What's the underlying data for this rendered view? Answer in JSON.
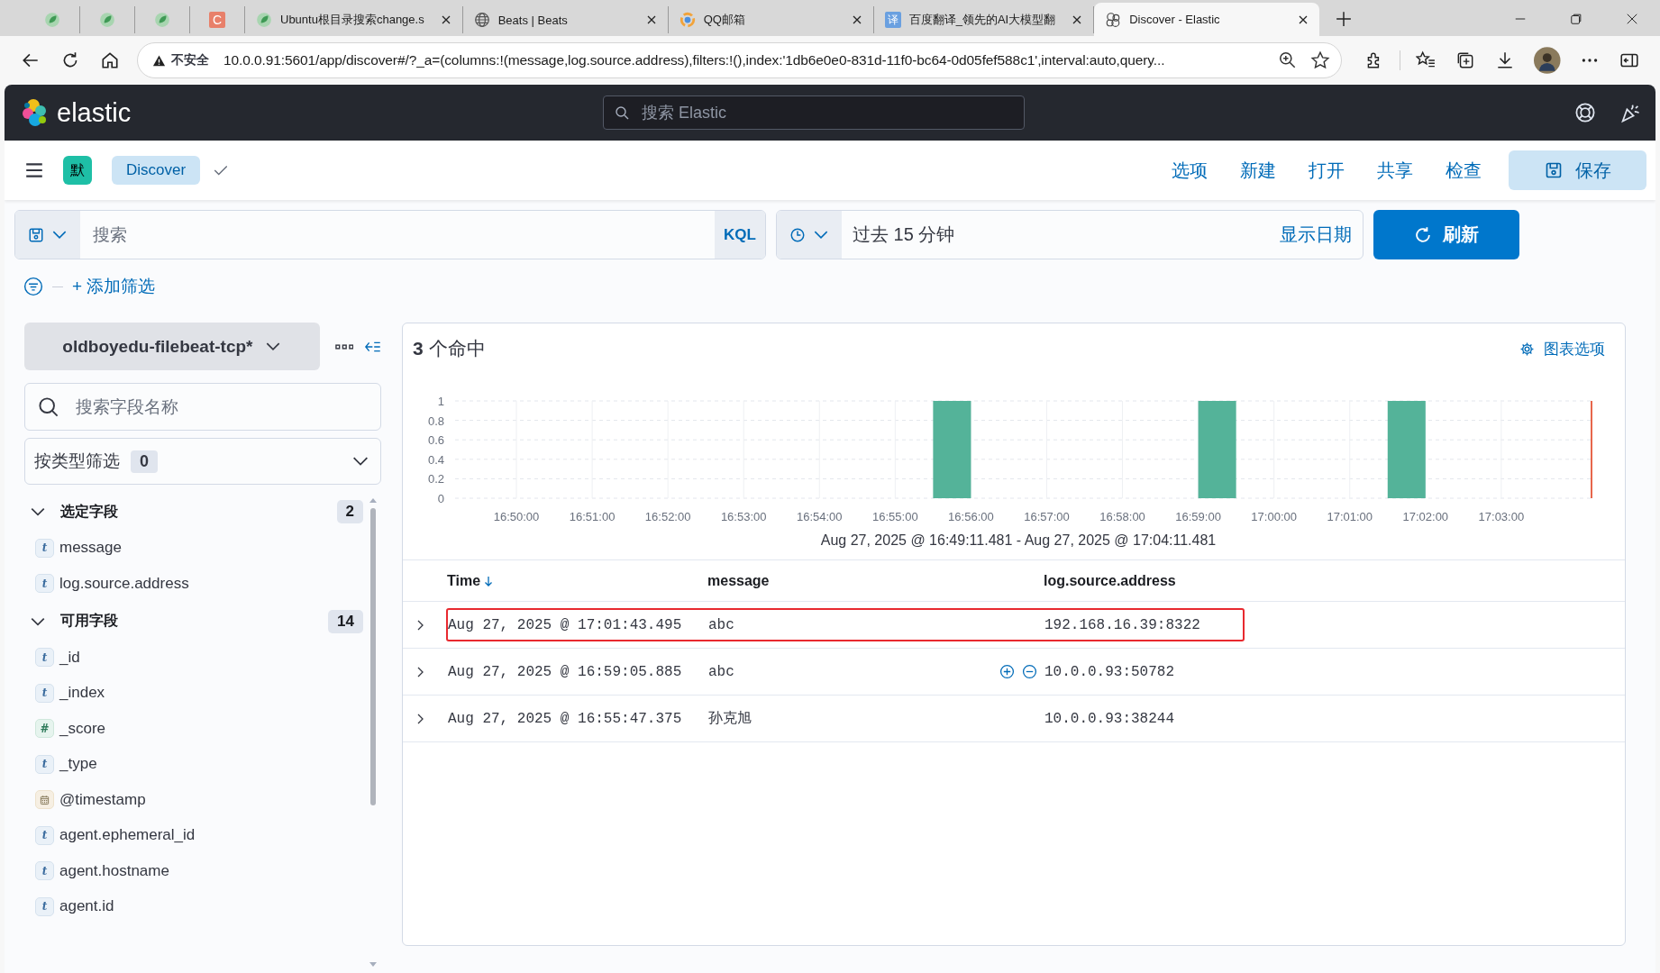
{
  "browser": {
    "tabs": [
      {
        "kind": "leaf",
        "selected": false
      },
      {
        "kind": "leaf",
        "selected": false
      },
      {
        "kind": "leaf",
        "selected": false
      },
      {
        "kind": "letter",
        "icon_text": "C",
        "selected": false
      },
      {
        "kind": "leaf",
        "title": "Ubuntu根目录搜索change.s",
        "selected": false
      },
      {
        "kind": "globe",
        "title": "Beats | Beats",
        "selected": false
      },
      {
        "kind": "ring",
        "title": "QQ邮箱",
        "selected": false
      },
      {
        "kind": "translate",
        "icon_text": "译",
        "title": "百度翻译_领先的AI大模型翻",
        "selected": false
      },
      {
        "kind": "elastic",
        "title": "Discover - Elastic",
        "selected": true
      }
    ],
    "security_label": "不安全",
    "url": "10.0.0.91:5601/app/discover#/?_a=(columns:!(message,log.source.address),filters:!(),index:'1db6e0e0-831d-11f0-bc64-0d05fef588c1',interval:auto,query..."
  },
  "header": {
    "brand": "elastic",
    "search_placeholder": "搜索 Elastic"
  },
  "app_bar": {
    "space_initial": "默",
    "breadcrumb": "Discover",
    "menu": [
      "选项",
      "新建",
      "打开",
      "共享",
      "检查"
    ],
    "save_label": "保存"
  },
  "query": {
    "placeholder": "搜索",
    "language": "KQL",
    "time_range": "过去 15 分钟",
    "show_dates": "显示日期",
    "refresh_label": "刷新"
  },
  "filters": {
    "add_label": "+ 添加筛选"
  },
  "sidebar": {
    "index_pattern": "oldboyedu-filebeat-tcp*",
    "field_search_placeholder": "搜索字段名称",
    "type_filter": {
      "label": "按类型筛选",
      "count": "0"
    },
    "sections": [
      {
        "title": "选定字段",
        "count": "2",
        "expanded": true,
        "fields": [
          {
            "name": "message",
            "kind": "string",
            "type_icon": "t"
          },
          {
            "name": "log.source.address",
            "kind": "string",
            "type_icon": "t"
          }
        ]
      },
      {
        "title": "可用字段",
        "count": "14",
        "expanded": true,
        "fields": [
          {
            "name": "_id",
            "kind": "string",
            "type_icon": "t"
          },
          {
            "name": "_index",
            "kind": "string",
            "type_icon": "t"
          },
          {
            "name": "_score",
            "kind": "number",
            "type_icon": "#"
          },
          {
            "name": "_type",
            "kind": "string",
            "type_icon": "t"
          },
          {
            "name": "@timestamp",
            "kind": "date"
          },
          {
            "name": "agent.ephemeral_id",
            "kind": "string",
            "type_icon": "t"
          },
          {
            "name": "agent.hostname",
            "kind": "string",
            "type_icon": "t"
          },
          {
            "name": "agent.id",
            "kind": "string",
            "type_icon": "t"
          }
        ]
      }
    ]
  },
  "results": {
    "hits_count": "3",
    "hits_label": "个命中",
    "chart_options": "图表选项",
    "chart_data": {
      "type": "bar",
      "x": [
        1015.75,
        1019.25,
        1021.75
      ],
      "values": [
        1,
        1,
        1
      ],
      "color": "#54b399",
      "grid": true,
      "xlim": [
        1009.191,
        1024.191
      ],
      "ylim": [
        0,
        1
      ],
      "yticks": [
        {
          "value": 0,
          "label": "0"
        },
        {
          "value": 0.2,
          "label": "0.2"
        },
        {
          "value": 0.4,
          "label": "0.4"
        },
        {
          "value": 0.6,
          "label": "0.6"
        },
        {
          "value": 0.8,
          "label": "0.8"
        },
        {
          "value": 1,
          "label": "1"
        }
      ],
      "xticks": [
        {
          "value": 1010,
          "label": "16:50:00"
        },
        {
          "value": 1011,
          "label": "16:51:00"
        },
        {
          "value": 1012,
          "label": "16:52:00"
        },
        {
          "value": 1013,
          "label": "16:53:00"
        },
        {
          "value": 1014,
          "label": "16:54:00"
        },
        {
          "value": 1015,
          "label": "16:55:00"
        },
        {
          "value": 1016,
          "label": "16:56:00"
        },
        {
          "value": 1017,
          "label": "16:57:00"
        },
        {
          "value": 1018,
          "label": "16:58:00"
        },
        {
          "value": 1019,
          "label": "16:59:00"
        },
        {
          "value": 1020,
          "label": "17:00:00"
        },
        {
          "value": 1021,
          "label": "17:01:00"
        },
        {
          "value": 1022,
          "label": "17:02:00"
        },
        {
          "value": 1023,
          "label": "17:03:00"
        }
      ]
    },
    "time_range": "Aug 27, 2025 @ 16:49:11.481 - Aug 27, 2025 @ 17:04:11.481",
    "table": {
      "columns": [
        {
          "label": "Time",
          "sorted": true
        },
        {
          "label": "message",
          "sorted": false
        },
        {
          "label": "log.source.address",
          "sorted": false
        }
      ],
      "rows": [
        {
          "time": "Aug 27, 2025 @ 17:01:43.495",
          "message": "abc",
          "address": "192.168.16.39:8322",
          "highlighted": true,
          "hovered": false
        },
        {
          "time": "Aug 27, 2025 @ 16:59:05.885",
          "message": "abc",
          "address": "10.0.0.93:50782",
          "highlighted": false,
          "hovered": true
        },
        {
          "time": "Aug 27, 2025 @ 16:55:47.375",
          "message": "孙克旭",
          "address": "10.0.0.93:38244",
          "highlighted": false,
          "hovered": false
        }
      ]
    }
  }
}
